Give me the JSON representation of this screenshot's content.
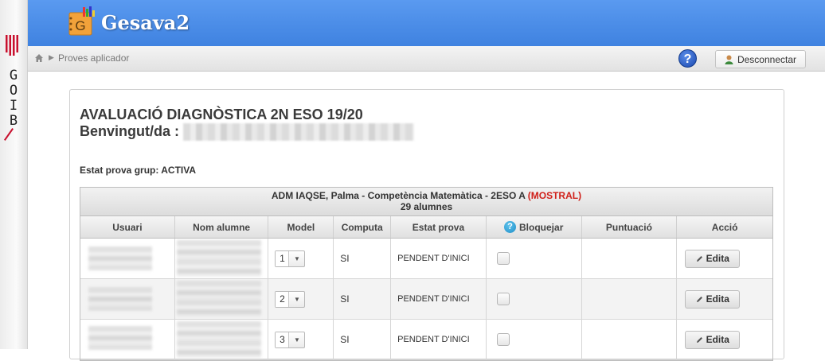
{
  "gov": {
    "letters": [
      "G",
      "O",
      "I",
      "B"
    ]
  },
  "app": {
    "title": "Gesava2",
    "logo_letter": "G"
  },
  "breadcrumb": {
    "item": "Proves aplicador"
  },
  "topbar": {
    "help": "?",
    "logout_label": "Desconnectar"
  },
  "page": {
    "title": "AVALUACIÓ DIAGNÒSTICA 2N ESO 19/20",
    "welcome_label": "Benvingut/da :",
    "status": "Estat prova grup: ACTIVA"
  },
  "grid": {
    "caption": "ADM IAQSE, Palma - Competència Matemàtica - 2ESO A",
    "caption_tag": "(MOSTRAL)",
    "count": "29 alumnes",
    "columns": [
      "Usuari",
      "Nom alumne",
      "Model",
      "Computa",
      "Estat prova",
      "Bloquejar",
      "Puntuació",
      "Acció"
    ],
    "rows": [
      {
        "model": "1",
        "computa": "SI",
        "estat": "PENDENT D'INICI",
        "puntuacio": "",
        "accio": "Edita"
      },
      {
        "model": "2",
        "computa": "SI",
        "estat": "PENDENT D'INICI",
        "puntuacio": "",
        "accio": "Edita"
      },
      {
        "model": "3",
        "computa": "SI",
        "estat": "PENDENT D'INICI",
        "puntuacio": "",
        "accio": "Edita"
      }
    ]
  },
  "colors": {
    "header": "#4a8de6",
    "mostral": "#d0201a",
    "gov_slash": "#c8102e"
  }
}
